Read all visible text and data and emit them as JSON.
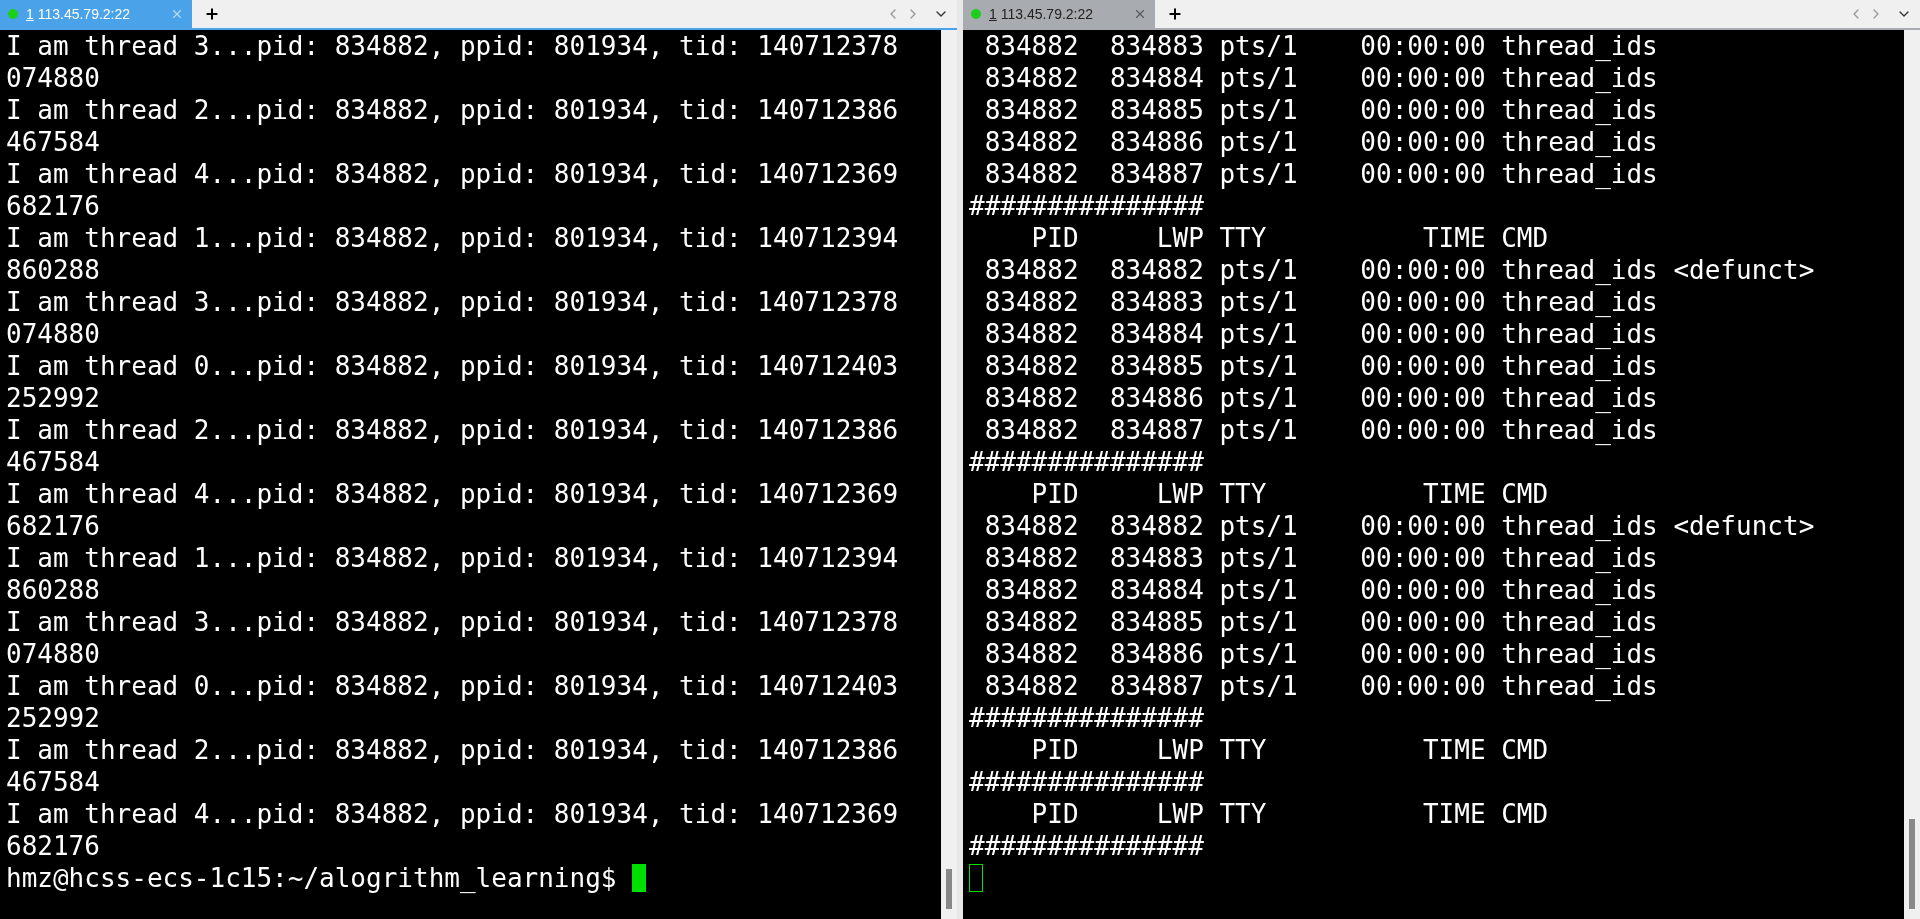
{
  "panes": [
    {
      "tab": {
        "number": "1",
        "host": "113.45.79.2:22"
      },
      "focused": true,
      "lines": [
        "I am thread 3...pid: 834882, ppid: 801934, tid: 140712378",
        "074880",
        "I am thread 2...pid: 834882, ppid: 801934, tid: 140712386",
        "467584",
        "I am thread 4...pid: 834882, ppid: 801934, tid: 140712369",
        "682176",
        "I am thread 1...pid: 834882, ppid: 801934, tid: 140712394",
        "860288",
        "I am thread 3...pid: 834882, ppid: 801934, tid: 140712378",
        "074880",
        "I am thread 0...pid: 834882, ppid: 801934, tid: 140712403",
        "252992",
        "I am thread 2...pid: 834882, ppid: 801934, tid: 140712386",
        "467584",
        "I am thread 4...pid: 834882, ppid: 801934, tid: 140712369",
        "682176",
        "I am thread 1...pid: 834882, ppid: 801934, tid: 140712394",
        "860288",
        "I am thread 3...pid: 834882, ppid: 801934, tid: 140712378",
        "074880",
        "I am thread 0...pid: 834882, ppid: 801934, tid: 140712403",
        "252992",
        "I am thread 2...pid: 834882, ppid: 801934, tid: 140712386",
        "467584",
        "I am thread 4...pid: 834882, ppid: 801934, tid: 140712369",
        "682176"
      ],
      "prompt": "hmz@hcss-ecs-1c15:~/alogrithm_learning$ "
    },
    {
      "tab": {
        "number": "1",
        "host": "113.45.79.2:22"
      },
      "focused": false,
      "lines": [
        " 834882  834883 pts/1    00:00:00 thread_ids",
        " 834882  834884 pts/1    00:00:00 thread_ids",
        " 834882  834885 pts/1    00:00:00 thread_ids",
        " 834882  834886 pts/1    00:00:00 thread_ids",
        " 834882  834887 pts/1    00:00:00 thread_ids",
        "###############",
        "    PID     LWP TTY          TIME CMD",
        " 834882  834882 pts/1    00:00:00 thread_ids <defunct>",
        " 834882  834883 pts/1    00:00:00 thread_ids",
        " 834882  834884 pts/1    00:00:00 thread_ids",
        " 834882  834885 pts/1    00:00:00 thread_ids",
        " 834882  834886 pts/1    00:00:00 thread_ids",
        " 834882  834887 pts/1    00:00:00 thread_ids",
        "###############",
        "    PID     LWP TTY          TIME CMD",
        " 834882  834882 pts/1    00:00:00 thread_ids <defunct>",
        " 834882  834883 pts/1    00:00:00 thread_ids",
        " 834882  834884 pts/1    00:00:00 thread_ids",
        " 834882  834885 pts/1    00:00:00 thread_ids",
        " 834882  834886 pts/1    00:00:00 thread_ids",
        " 834882  834887 pts/1    00:00:00 thread_ids",
        "###############",
        "    PID     LWP TTY          TIME CMD",
        "###############",
        "    PID     LWP TTY          TIME CMD",
        "###############"
      ]
    }
  ]
}
